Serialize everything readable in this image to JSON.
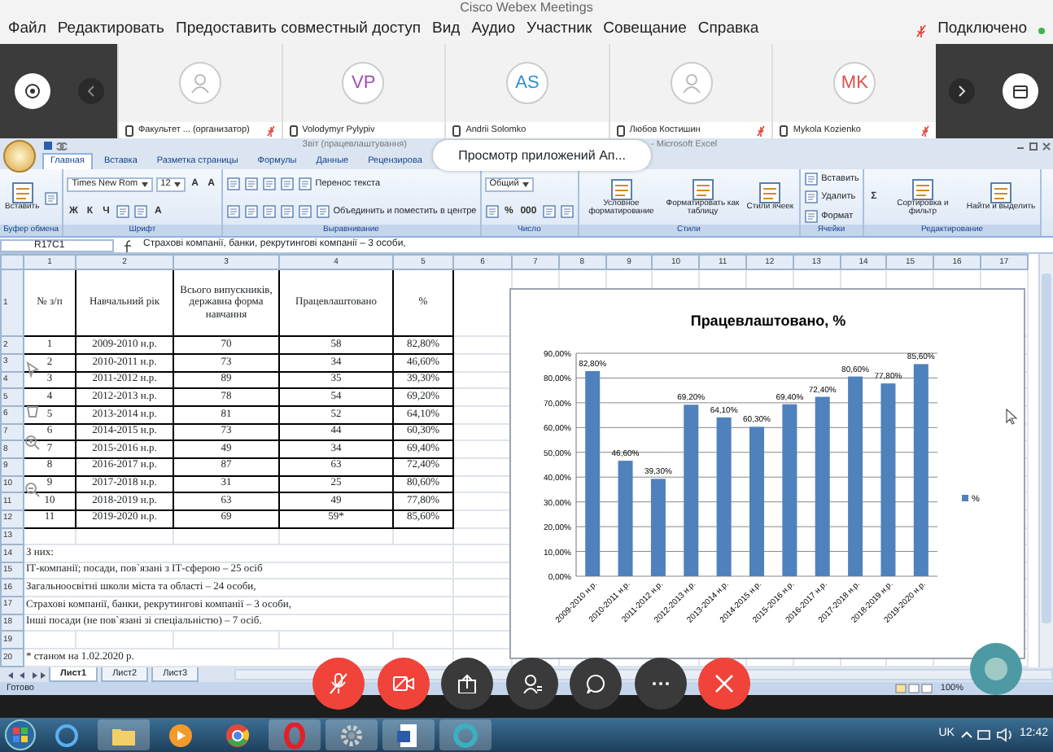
{
  "window": {
    "title": "Cisco Webex Meetings"
  },
  "menu": [
    "Файл",
    "Редактировать",
    "Предоставить совместный доступ",
    "Вид",
    "Аудио",
    "Участник",
    "Совещание",
    "Справка"
  ],
  "connection": {
    "label": "Подключено",
    "connected": true
  },
  "participants": [
    {
      "kind": "avatar",
      "name": "Факультет ... (организатор)",
      "muted": true
    },
    {
      "kind": "initials",
      "initials": "VP",
      "color": "#9b4fb0",
      "name": "Volodymyr Pylypiv",
      "muted": false
    },
    {
      "kind": "initials",
      "initials": "AS",
      "color": "#2f8fd0",
      "name": "Andrii Solomko",
      "muted": false
    },
    {
      "kind": "avatar",
      "name": "Любов Костишин",
      "muted": true
    },
    {
      "kind": "initials",
      "initials": "MK",
      "color": "#d9534f",
      "name": "Mykola Kozienko",
      "muted": true
    }
  ],
  "excel": {
    "title_parts": [
      "Звіт (працевлаштування)",
      "- Microsoft Excel"
    ],
    "tabs": [
      {
        "label": "Главная",
        "selected": true
      },
      {
        "label": "Вставка",
        "selected": false
      },
      {
        "label": "Разметка страницы",
        "selected": false
      },
      {
        "label": "Формулы",
        "selected": false
      },
      {
        "label": "Данные",
        "selected": false
      },
      {
        "label": "Рецензирова",
        "selected": false
      }
    ],
    "popup": "Просмотр приложений Ап...",
    "ribbon": [
      {
        "label": "Буфер обмена",
        "lines": [
          {
            "items": [
              {
                "kind": "big",
                "label": "Вставить"
              },
              {
                "kind": "icon"
              }
            ]
          }
        ]
      },
      {
        "label": "Шрифт",
        "lines": [
          {
            "items": [
              {
                "kind": "field",
                "label": "Times New Rom"
              },
              {
                "kind": "field",
                "label": "12"
              },
              {
                "kind": "glyph",
                "label": "A"
              },
              {
                "kind": "glyph",
                "label": "A"
              }
            ]
          },
          {
            "items": [
              {
                "kind": "glyph",
                "label": "Ж"
              },
              {
                "kind": "glyph",
                "label": "К"
              },
              {
                "kind": "glyph",
                "label": "Ч"
              },
              {
                "kind": "icon"
              },
              {
                "kind": "icon"
              },
              {
                "kind": "glyph",
                "label": "A"
              }
            ]
          }
        ]
      },
      {
        "label": "Выравнивание",
        "lines": [
          {
            "items": [
              {
                "kind": "icon"
              },
              {
                "kind": "icon"
              },
              {
                "kind": "icon"
              },
              {
                "kind": "icon"
              },
              {
                "kind": "small",
                "label": "Перенос текста"
              }
            ]
          },
          {
            "items": [
              {
                "kind": "icon"
              },
              {
                "kind": "icon"
              },
              {
                "kind": "icon"
              },
              {
                "kind": "icon"
              },
              {
                "kind": "icon"
              },
              {
                "kind": "small",
                "label": "Объединить и поместить в центре"
              }
            ]
          }
        ]
      },
      {
        "label": "Число",
        "lines": [
          {
            "items": [
              {
                "kind": "field",
                "label": "Общий"
              }
            ]
          },
          {
            "items": [
              {
                "kind": "icon"
              },
              {
                "kind": "glyph",
                "label": "%"
              },
              {
                "kind": "glyph",
                "label": "000"
              },
              {
                "kind": "icon"
              },
              {
                "kind": "icon"
              }
            ]
          }
        ]
      },
      {
        "label": "Стили",
        "lines": [
          {
            "items": [
              {
                "kind": "big",
                "label": "Условное форматирование"
              },
              {
                "kind": "big",
                "label": "Форматировать как таблицу"
              },
              {
                "kind": "big",
                "label": "Стили ячеек"
              }
            ]
          }
        ]
      },
      {
        "label": "Ячейки",
        "lines": [
          {
            "items": [
              {
                "kind": "small",
                "label": "Вставить"
              }
            ]
          },
          {
            "items": [
              {
                "kind": "small",
                "label": "Удалить"
              }
            ]
          },
          {
            "items": [
              {
                "kind": "small",
                "label": "Формат"
              }
            ]
          }
        ]
      },
      {
        "label": "Редактирование",
        "lines": [
          {
            "items": [
              {
                "kind": "glyph",
                "label": "Σ"
              },
              {
                "kind": "big",
                "label": "Сортировка и фильтр"
              },
              {
                "kind": "big",
                "label": "Найти и выделить"
              }
            ]
          }
        ]
      }
    ],
    "formula_bar": {
      "cell": "R17C1",
      "value": "Страхові компанії, банки, рекрутингові компанії  – 3 особи,"
    },
    "sheet": {
      "column_headers": [
        "1",
        "2",
        "3",
        "4",
        "5",
        "6",
        "7",
        "8",
        "9",
        "10",
        "11",
        "12",
        "13",
        "14",
        "15",
        "16",
        "17"
      ],
      "row_numbers": [
        "1",
        "2",
        "3",
        "4",
        "5",
        "6",
        "7",
        "8",
        "9",
        "10",
        "11",
        "12",
        "13",
        "14",
        "15",
        "16",
        "17",
        "18",
        "19",
        "20"
      ],
      "header": [
        "№ з/п",
        "Навчальний рік",
        "Всього випускників, державна форма навчання",
        "Працевлаштовано",
        "%"
      ],
      "rows": [
        [
          "1",
          "2009-2010 н.р.",
          "70",
          "58",
          "82,80%"
        ],
        [
          "2",
          "2010-2011 н.р.",
          "73",
          "34",
          "46,60%"
        ],
        [
          "3",
          "2011-2012 н.р.",
          "89",
          "35",
          "39,30%"
        ],
        [
          "4",
          "2012-2013 н.р.",
          "78",
          "54",
          "69,20%"
        ],
        [
          "5",
          "2013-2014 н.р.",
          "81",
          "52",
          "64,10%"
        ],
        [
          "6",
          "2014-2015 н.р.",
          "73",
          "44",
          "60,30%"
        ],
        [
          "7",
          "2015-2016 н.р.",
          "49",
          "34",
          "69,40%"
        ],
        [
          "8",
          "2016-2017 н.р.",
          "87",
          "63",
          "72,40%"
        ],
        [
          "9",
          "2017-2018 н.р.",
          "31",
          "25",
          "80,60%"
        ],
        [
          "10",
          "2018-2019 н.р.",
          "63",
          "49",
          "77,80%"
        ],
        [
          "11",
          "2019-2020 н.р.",
          "69",
          "59*",
          "85,60%"
        ]
      ],
      "notes": [
        "З них:",
        "ІТ-компанії; посади, пов`язані з ІТ-сферою  – 25 осіб",
        "Загальноосвітні школи міста та області – 24 особи,",
        "Страхові компанії, банки, рекрутингові компанії  – 3 особи,",
        "Інші посади (не пов`язані зі спеціальністю) – 7 осіб."
      ],
      "footnote": "* станом на 1.02.2020 р."
    },
    "chart": {
      "chart_data": {
        "type": "bar",
        "title": "Працевлаштовано, %",
        "categories": [
          "2009-2010 н.р.",
          "2010-2011 н.р.",
          "2011-2012 н.р.",
          "2012-2013 н.р.",
          "2013-2014 н.р.",
          "2014-2015 н.р.",
          "2015-2016 н.р.",
          "2016-2017 н.р.",
          "2017-2018 н.р.",
          "2018-2019 н.р.",
          "2019-2020 н.р."
        ],
        "series": [
          {
            "name": "%",
            "color": "#4f81bd",
            "values": [
              82.8,
              46.6,
              39.3,
              69.2,
              64.1,
              60.3,
              69.4,
              72.4,
              80.6,
              77.8,
              85.6
            ]
          }
        ],
        "value_labels": [
          "82,80%",
          "46,60%",
          "39,30%",
          "69,20%",
          "64,10%",
          "60,30%",
          "69,40%",
          "72,40%",
          "80,60%",
          "77,80%",
          "85,60%"
        ],
        "ylim": [
          0,
          90
        ],
        "grid": true,
        "yticks": [
          {
            "value": 0,
            "label": "0,00%"
          },
          {
            "value": 10,
            "label": "10,00%"
          },
          {
            "value": 20,
            "label": "20,00%"
          },
          {
            "value": 30,
            "label": "30,00%"
          },
          {
            "value": 40,
            "label": "40,00%"
          },
          {
            "value": 50,
            "label": "50,00%"
          },
          {
            "value": 60,
            "label": "60,00%"
          },
          {
            "value": 70,
            "label": "70,00%"
          },
          {
            "value": 80,
            "label": "80,00%"
          },
          {
            "value": 90,
            "label": "90,00%"
          }
        ]
      }
    },
    "sheet_tabs": [
      {
        "label": "Лист1",
        "selected": true
      },
      {
        "label": "Лист2",
        "selected": false
      },
      {
        "label": "Лист3",
        "selected": false
      }
    ],
    "status": "Готово",
    "zoom": "100%"
  },
  "call_controls": {
    "muted": true,
    "video_off": true
  },
  "taskbar": {
    "language": "UK",
    "time": "12:42"
  }
}
